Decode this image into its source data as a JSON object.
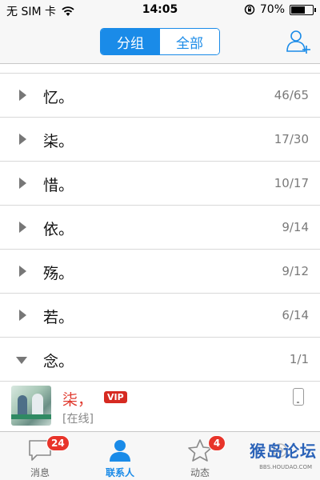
{
  "status_bar": {
    "carrier": "无 SIM 卡",
    "time": "14:05",
    "battery": "70%",
    "battery_level": 0.7
  },
  "nav": {
    "segments": [
      {
        "label": "分组",
        "active": true
      },
      {
        "label": "全部",
        "active": false
      }
    ],
    "add_icon": "add-friend-icon"
  },
  "groups": [
    {
      "name": "忆。",
      "count": "46/65",
      "expanded": false
    },
    {
      "name": "柒。",
      "count": "17/30",
      "expanded": false
    },
    {
      "name": "惜。",
      "count": "10/17",
      "expanded": false
    },
    {
      "name": "依。",
      "count": "9/14",
      "expanded": false
    },
    {
      "name": "殇。",
      "count": "9/12",
      "expanded": false
    },
    {
      "name": "若。",
      "count": "6/14",
      "expanded": false
    },
    {
      "name": "念。",
      "count": "1/1",
      "expanded": true
    }
  ],
  "contact": {
    "name": "柒，",
    "vip": "VIP",
    "status": "[在线]",
    "device_icon": "phone-icon"
  },
  "tabs": [
    {
      "label": "消息",
      "icon": "chat-bubble-icon",
      "badge": "24",
      "active": false
    },
    {
      "label": "联系人",
      "icon": "person-icon",
      "badge": "",
      "active": true
    },
    {
      "label": "动态",
      "icon": "star-icon",
      "badge": "4",
      "active": false
    },
    {
      "label": "",
      "icon": "gear-icon",
      "badge": "",
      "active": false
    }
  ],
  "watermark": {
    "text": "猴岛论坛",
    "url": "BBS.HOUDAO.COM"
  },
  "colors": {
    "accent": "#1a8be8",
    "badge": "#e8342a",
    "vip_name": "#e03a2f"
  }
}
